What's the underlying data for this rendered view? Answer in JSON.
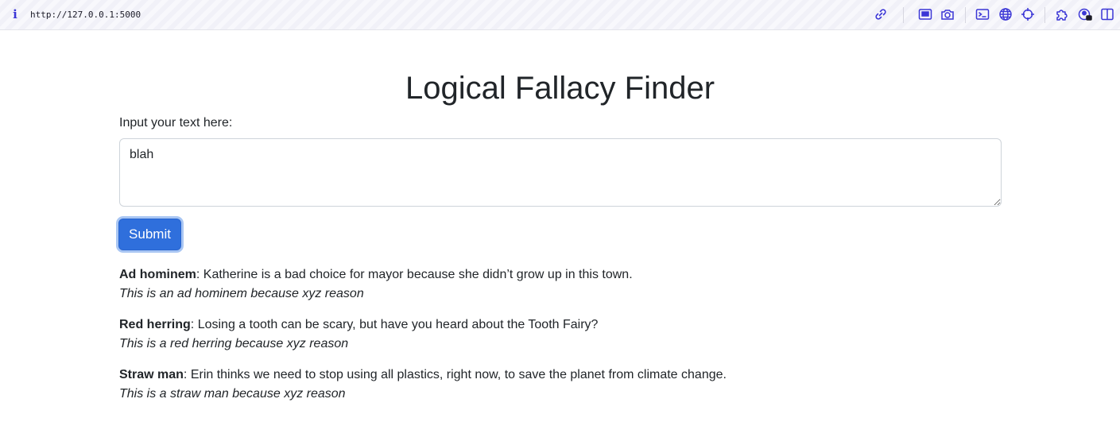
{
  "browser": {
    "url": "http://127.0.0.1:5000",
    "icons": [
      "link-icon",
      "picture-in-picture-icon",
      "camera-icon",
      "terminal-icon",
      "globe-icon",
      "crosshair-icon",
      "extensions-icon",
      "lock-user-icon",
      "sidebar-icon"
    ],
    "accent_color": "#3b36d6"
  },
  "page": {
    "title": "Logical Fallacy Finder",
    "input_label": "Input your text here:",
    "input_value": "blah",
    "submit_label": "Submit"
  },
  "results": [
    {
      "name": "Ad hominem",
      "example": ": Katherine is a bad choice for mayor because she didn’t grow up in this town.",
      "reason": "This is an ad hominem because xyz reason"
    },
    {
      "name": "Red herring",
      "example": ": Losing a tooth can be scary, but have you heard about the Tooth Fairy?",
      "reason": "This is a red herring because xyz reason"
    },
    {
      "name": "Straw man",
      "example": ": Erin thinks we need to stop using all plastics, right now, to save the planet from climate change.",
      "reason": "This is a straw man because xyz reason"
    }
  ]
}
